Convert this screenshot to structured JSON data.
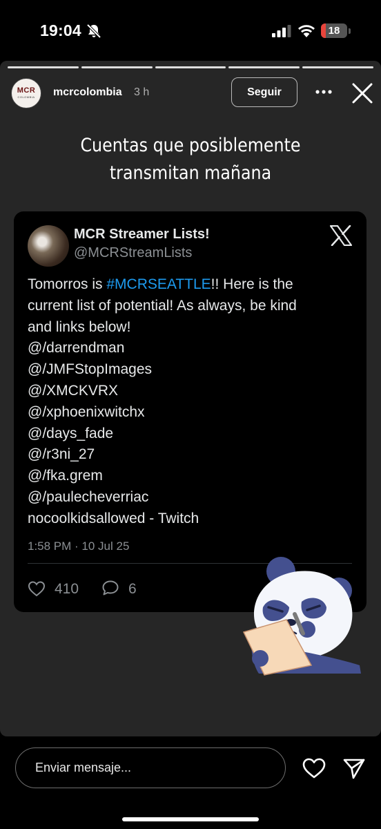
{
  "status_bar": {
    "time": "19:04",
    "battery_level": "18",
    "battery_fraction": 0.18,
    "battery_color": "#e8453c",
    "icons": [
      "bell-off-icon",
      "signal-icon",
      "wifi-icon",
      "battery-icon"
    ]
  },
  "story": {
    "progress_segments": 5,
    "account": {
      "username": "mcrcolombia",
      "time_ago": "3 h",
      "avatar_logo": "MCR",
      "avatar_logo_sub": "COLOMBIA"
    },
    "follow_label": "Seguir",
    "caption_lines": [
      "Cuentas que posiblemente",
      "transmitan mañana"
    ],
    "tweet": {
      "display_name": "MCR Streamer Lists!",
      "handle": "@MCRStreamLists",
      "body_prefix": "Tomorros is ",
      "hashtag": "#MCRSEATTLE",
      "body_lines": [
        "!! Here is the",
        "current list of potential! As always, be kind",
        "and links below!",
        "@/darrendman",
        "@/JMFStopImages",
        "@/XMCKVRX",
        "@/xphoenixwitchx",
        "@/days_fade",
        "@/r3ni_27",
        "@/fka.grem",
        "@/paulecheverriac",
        "nocoolkidsallowed - Twitch"
      ],
      "timestamp": "1:58 PM · 10 Jul 25",
      "likes": "410",
      "replies": "6",
      "hashtag_color": "#1d9bf0"
    },
    "sticker": "panda-writing-sticker"
  },
  "bottom_bar": {
    "message_placeholder": "Enviar mensaje...",
    "icons": [
      "heart-icon",
      "send-icon"
    ]
  }
}
